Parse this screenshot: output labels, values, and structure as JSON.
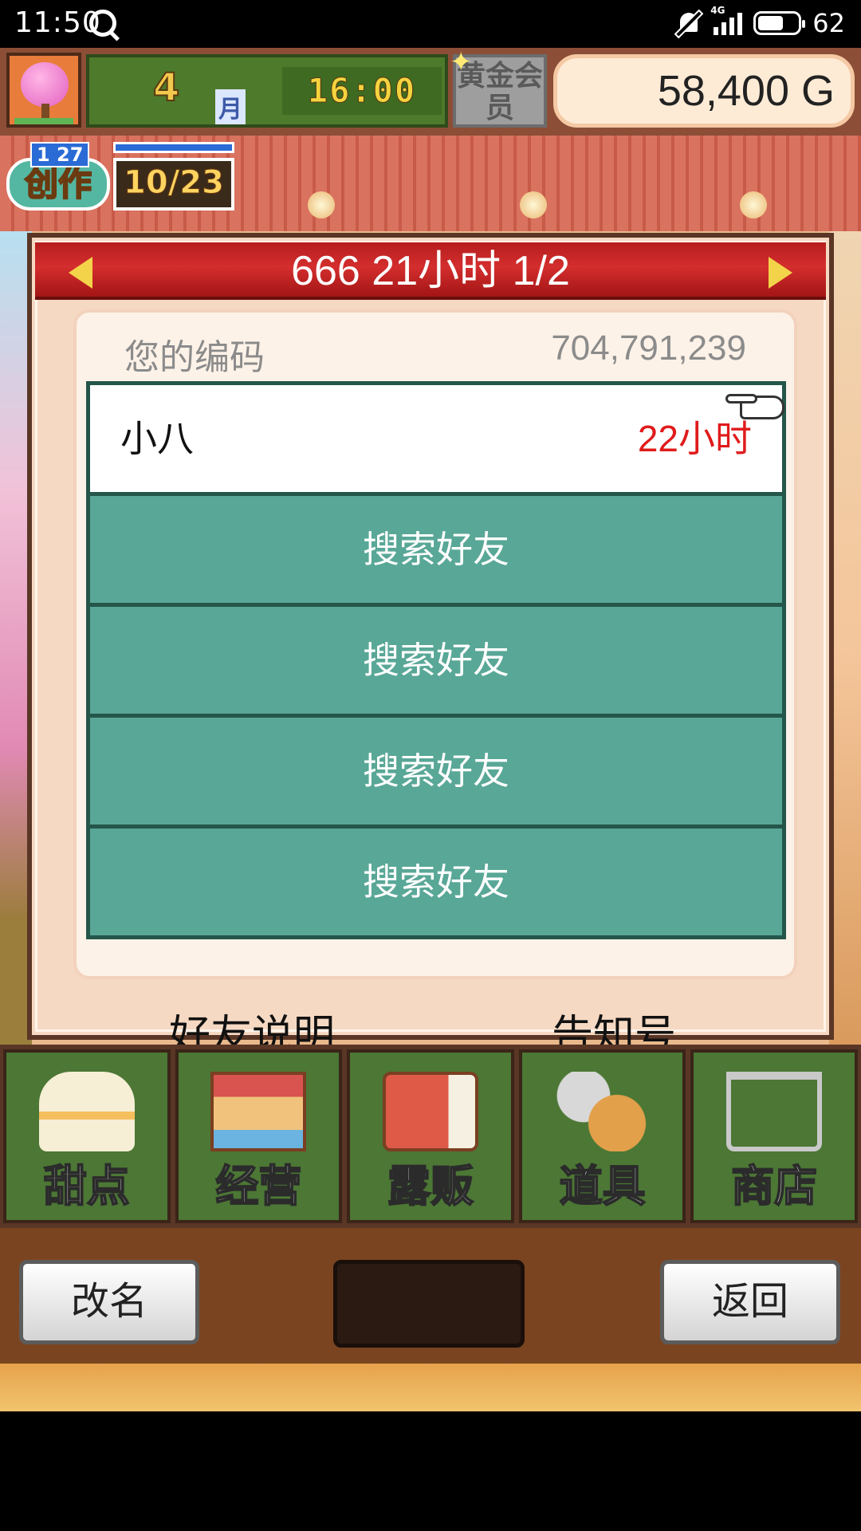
{
  "status_bar": {
    "time": "11:50",
    "network": "4G",
    "battery": "62",
    "icons": [
      "q-icon",
      "bell-mute-icon",
      "signal-icon",
      "battery-icon"
    ]
  },
  "hud": {
    "month_number": "4",
    "month_label": "月",
    "clock": "16:00",
    "gold_member": "黄金会员",
    "money": "58,400 G"
  },
  "create": {
    "day": "1 27",
    "label": "创作",
    "progress": "10/23"
  },
  "panel": {
    "title": "666  21小时 1/2",
    "code_label": "您的编码",
    "code_value": "704,791,239",
    "friend": {
      "name": "小八",
      "time": "22小时"
    },
    "search_slots": [
      "搜索好友",
      "搜索好友",
      "搜索好友",
      "搜索好友"
    ],
    "link_explain": "好友说明",
    "link_notice": "告知号"
  },
  "nav": {
    "items": [
      "甜点",
      "经营",
      "露贩",
      "道具",
      "商店"
    ]
  },
  "bottom": {
    "rename": "改名",
    "back": "返回"
  },
  "colors": {
    "title_red": "#c92222",
    "teal": "#59a797",
    "time_red": "#e01b1b",
    "nav_green": "#4c7735"
  }
}
